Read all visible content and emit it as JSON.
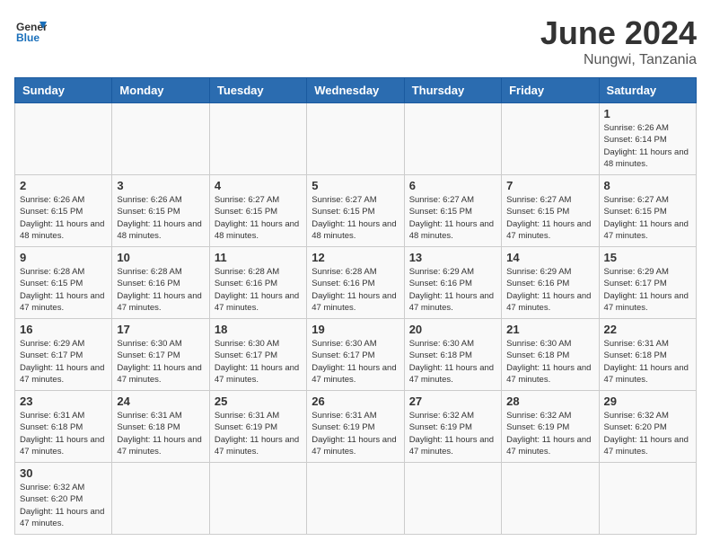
{
  "header": {
    "logo_general": "General",
    "logo_blue": "Blue",
    "month": "June 2024",
    "location": "Nungwi, Tanzania"
  },
  "weekdays": [
    "Sunday",
    "Monday",
    "Tuesday",
    "Wednesday",
    "Thursday",
    "Friday",
    "Saturday"
  ],
  "days": {
    "1": {
      "sunrise": "6:26 AM",
      "sunset": "6:14 PM",
      "daylight": "11 hours and 48 minutes."
    },
    "2": {
      "sunrise": "6:26 AM",
      "sunset": "6:15 PM",
      "daylight": "11 hours and 48 minutes."
    },
    "3": {
      "sunrise": "6:26 AM",
      "sunset": "6:15 PM",
      "daylight": "11 hours and 48 minutes."
    },
    "4": {
      "sunrise": "6:27 AM",
      "sunset": "6:15 PM",
      "daylight": "11 hours and 48 minutes."
    },
    "5": {
      "sunrise": "6:27 AM",
      "sunset": "6:15 PM",
      "daylight": "11 hours and 48 minutes."
    },
    "6": {
      "sunrise": "6:27 AM",
      "sunset": "6:15 PM",
      "daylight": "11 hours and 48 minutes."
    },
    "7": {
      "sunrise": "6:27 AM",
      "sunset": "6:15 PM",
      "daylight": "11 hours and 47 minutes."
    },
    "8": {
      "sunrise": "6:27 AM",
      "sunset": "6:15 PM",
      "daylight": "11 hours and 47 minutes."
    },
    "9": {
      "sunrise": "6:28 AM",
      "sunset": "6:15 PM",
      "daylight": "11 hours and 47 minutes."
    },
    "10": {
      "sunrise": "6:28 AM",
      "sunset": "6:16 PM",
      "daylight": "11 hours and 47 minutes."
    },
    "11": {
      "sunrise": "6:28 AM",
      "sunset": "6:16 PM",
      "daylight": "11 hours and 47 minutes."
    },
    "12": {
      "sunrise": "6:28 AM",
      "sunset": "6:16 PM",
      "daylight": "11 hours and 47 minutes."
    },
    "13": {
      "sunrise": "6:29 AM",
      "sunset": "6:16 PM",
      "daylight": "11 hours and 47 minutes."
    },
    "14": {
      "sunrise": "6:29 AM",
      "sunset": "6:16 PM",
      "daylight": "11 hours and 47 minutes."
    },
    "15": {
      "sunrise": "6:29 AM",
      "sunset": "6:17 PM",
      "daylight": "11 hours and 47 minutes."
    },
    "16": {
      "sunrise": "6:29 AM",
      "sunset": "6:17 PM",
      "daylight": "11 hours and 47 minutes."
    },
    "17": {
      "sunrise": "6:30 AM",
      "sunset": "6:17 PM",
      "daylight": "11 hours and 47 minutes."
    },
    "18": {
      "sunrise": "6:30 AM",
      "sunset": "6:17 PM",
      "daylight": "11 hours and 47 minutes."
    },
    "19": {
      "sunrise": "6:30 AM",
      "sunset": "6:17 PM",
      "daylight": "11 hours and 47 minutes."
    },
    "20": {
      "sunrise": "6:30 AM",
      "sunset": "6:18 PM",
      "daylight": "11 hours and 47 minutes."
    },
    "21": {
      "sunrise": "6:30 AM",
      "sunset": "6:18 PM",
      "daylight": "11 hours and 47 minutes."
    },
    "22": {
      "sunrise": "6:31 AM",
      "sunset": "6:18 PM",
      "daylight": "11 hours and 47 minutes."
    },
    "23": {
      "sunrise": "6:31 AM",
      "sunset": "6:18 PM",
      "daylight": "11 hours and 47 minutes."
    },
    "24": {
      "sunrise": "6:31 AM",
      "sunset": "6:18 PM",
      "daylight": "11 hours and 47 minutes."
    },
    "25": {
      "sunrise": "6:31 AM",
      "sunset": "6:19 PM",
      "daylight": "11 hours and 47 minutes."
    },
    "26": {
      "sunrise": "6:31 AM",
      "sunset": "6:19 PM",
      "daylight": "11 hours and 47 minutes."
    },
    "27": {
      "sunrise": "6:32 AM",
      "sunset": "6:19 PM",
      "daylight": "11 hours and 47 minutes."
    },
    "28": {
      "sunrise": "6:32 AM",
      "sunset": "6:19 PM",
      "daylight": "11 hours and 47 minutes."
    },
    "29": {
      "sunrise": "6:32 AM",
      "sunset": "6:20 PM",
      "daylight": "11 hours and 47 minutes."
    },
    "30": {
      "sunrise": "6:32 AM",
      "sunset": "6:20 PM",
      "daylight": "11 hours and 47 minutes."
    }
  }
}
